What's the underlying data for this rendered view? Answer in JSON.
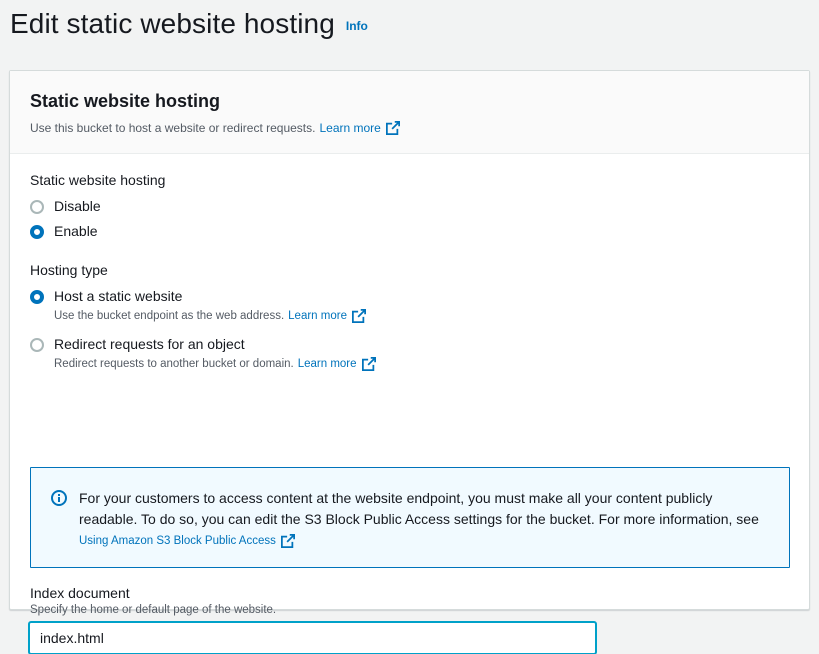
{
  "page": {
    "title": "Edit static website hosting",
    "info_label": "Info"
  },
  "panel": {
    "title": "Static website hosting",
    "description": "Use this bucket to host a website or redirect requests.",
    "learn_more": "Learn more"
  },
  "hosting_toggle": {
    "label": "Static website hosting",
    "options": [
      {
        "label": "Disable",
        "selected": false
      },
      {
        "label": "Enable",
        "selected": true
      }
    ]
  },
  "hosting_type": {
    "label": "Hosting type",
    "options": [
      {
        "label": "Host a static website",
        "description": "Use the bucket endpoint as the web address.",
        "learn_more": "Learn more",
        "selected": true
      },
      {
        "label": "Redirect requests for an object",
        "description": "Redirect requests to another bucket or domain.",
        "learn_more": "Learn more",
        "selected": false
      }
    ]
  },
  "alert": {
    "text": "For your customers to access content at the website endpoint, you must make all your content publicly readable. To do so, you can edit the S3 Block Public Access settings for the bucket. For more information, see",
    "link": "Using Amazon S3 Block Public Access"
  },
  "index_document": {
    "label": "Index document",
    "description": "Specify the home or default page of the website.",
    "value": "index.html"
  },
  "colors": {
    "link": "#0073bb",
    "radio_selected": "#0073bb",
    "alert_background": "#f1faff",
    "input_focus": "#00a1c9"
  }
}
